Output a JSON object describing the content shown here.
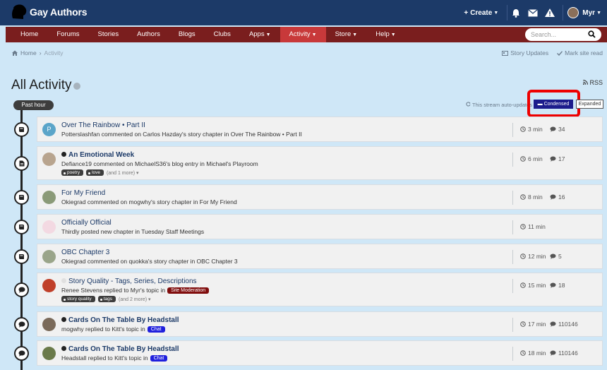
{
  "site": {
    "logo_text": "Gay Authors"
  },
  "header": {
    "create_label": "Create",
    "user_name": "Myr",
    "icons": [
      "bell-icon",
      "mail-icon",
      "warning-icon"
    ]
  },
  "nav": {
    "items": [
      {
        "label": "Home",
        "dropdown": false
      },
      {
        "label": "Forums",
        "dropdown": false
      },
      {
        "label": "Stories",
        "dropdown": false
      },
      {
        "label": "Authors",
        "dropdown": false
      },
      {
        "label": "Blogs",
        "dropdown": false
      },
      {
        "label": "Clubs",
        "dropdown": false
      },
      {
        "label": "Apps",
        "dropdown": true
      },
      {
        "label": "Activity",
        "dropdown": true,
        "active": true
      },
      {
        "label": "Store",
        "dropdown": true
      },
      {
        "label": "Help",
        "dropdown": true
      }
    ],
    "search_placeholder": "Search..."
  },
  "breadcrumb": {
    "home": "Home",
    "current": "Activity"
  },
  "actions": {
    "story_updates": "Story Updates",
    "mark_read": "Mark site read"
  },
  "page": {
    "title": "All Activity",
    "rss": "RSS",
    "period": "Past hour",
    "auto_update": "This stream auto-updates",
    "view_condensed": "Condensed",
    "view_expanded": "Expanded"
  },
  "colors": {
    "header": "#1c3a68",
    "nav": "#7a1e1e",
    "nav_active": "#c8393a",
    "condensed": "#1c1c8c",
    "highlight": "#ee0000"
  },
  "items": [
    {
      "title": "Over The Rainbow • Part II",
      "bold": false,
      "dot": null,
      "sub": "Potterslashfan commented on Carlos Hazday's story chapter in Over The Rainbow • Part II",
      "badge": null,
      "tags": [],
      "more": "",
      "time": "3 min",
      "comments": "34",
      "avatar_letter": "P",
      "node_icon": "book-icon"
    },
    {
      "title": "An Emotional Week",
      "bold": true,
      "dot": "dark",
      "sub": "Defiance19 commented on MichaelS36's blog entry in Michael's Playroom",
      "badge": null,
      "tags": [
        "poetry",
        "love"
      ],
      "more": "(and 1 more)",
      "time": "6 min",
      "comments": "17",
      "avatar_letter": "",
      "node_icon": "document-icon"
    },
    {
      "title": "For My Friend",
      "bold": false,
      "dot": null,
      "sub": "Okiegrad commented on mogwhy's story chapter in For My Friend",
      "badge": null,
      "tags": [],
      "more": "",
      "time": "8 min",
      "comments": "16",
      "avatar_letter": "",
      "node_icon": "book-icon"
    },
    {
      "title": "Officially Official",
      "bold": false,
      "dot": null,
      "sub": "Thirdly posted new chapter in Tuesday Staff Meetings",
      "badge": null,
      "tags": [],
      "more": "",
      "time": "11 min",
      "comments": "",
      "avatar_letter": "",
      "node_icon": "book-icon"
    },
    {
      "title": "OBC Chapter 3",
      "bold": false,
      "dot": null,
      "sub": "Okiegrad commented on quokka's story chapter in OBC Chapter 3",
      "badge": null,
      "tags": [],
      "more": "",
      "time": "12 min",
      "comments": "5",
      "avatar_letter": "",
      "node_icon": "book-icon"
    },
    {
      "title": "Story Quality - Tags, Series, Descriptions",
      "bold": false,
      "dot": "light",
      "sub": "Renee Stevens replied to Myr's topic in",
      "badge": {
        "text": "Site Moderation",
        "kind": "mod"
      },
      "tags": [
        "story quality",
        "tags"
      ],
      "more": "(and 2 more)",
      "time": "15 min",
      "comments": "18",
      "avatar_letter": "",
      "node_icon": "speech-bubble-icon"
    },
    {
      "title": "Cards On The Table By Headstall",
      "bold": true,
      "dot": "dark",
      "sub": "mogwhy replied to Kitt's topic in",
      "badge": {
        "text": "Chat",
        "kind": "chat"
      },
      "tags": [],
      "more": "",
      "time": "17 min",
      "comments": "110146",
      "avatar_letter": "",
      "node_icon": "speech-bubble-icon"
    },
    {
      "title": "Cards On The Table By Headstall",
      "bold": true,
      "dot": "dark",
      "sub": "Headstall replied to Kitt's topic in",
      "badge": {
        "text": "Chat",
        "kind": "chat"
      },
      "tags": [],
      "more": "",
      "time": "18 min",
      "comments": "110146",
      "avatar_letter": "",
      "node_icon": "speech-bubble-icon"
    }
  ]
}
